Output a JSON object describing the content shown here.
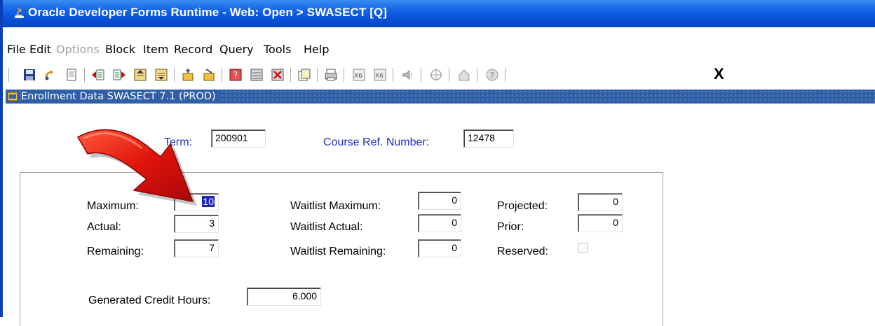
{
  "window": {
    "title": "Oracle Developer Forms Runtime - Web:  Open > SWASECT [Q]"
  },
  "menu": [
    {
      "label": "File",
      "enabled": true
    },
    {
      "label": "Edit",
      "enabled": true
    },
    {
      "label": "Options",
      "enabled": false
    },
    {
      "label": "Block",
      "enabled": true
    },
    {
      "label": "Item",
      "enabled": true
    },
    {
      "label": "Record",
      "enabled": true
    },
    {
      "label": "Query",
      "enabled": true
    },
    {
      "label": "Tools",
      "enabled": true
    },
    {
      "label": "Help",
      "enabled": true
    }
  ],
  "toolbar": {
    "exit_label": "X"
  },
  "form": {
    "title": "Enrollment Data  SWASECT  7.1  (PROD)"
  },
  "key": {
    "term_label": "Term:",
    "term_value": "200901",
    "crn_label": "Course Ref. Number:",
    "crn_value": "12478"
  },
  "enrollment": {
    "maximum_label": "Maximum:",
    "maximum_value": "10",
    "actual_label": "Actual:",
    "actual_value": "3",
    "remaining_label": "Remaining:",
    "remaining_value": "7",
    "wl_max_label": "Waitlist Maximum:",
    "wl_max_value": "0",
    "wl_actual_label": "Waitlist Actual:",
    "wl_actual_value": "0",
    "wl_remaining_label": "Waitlist Remaining:",
    "wl_remaining_value": "0",
    "projected_label": "Projected:",
    "projected_value": "0",
    "prior_label": "Prior:",
    "prior_value": "0",
    "reserved_label": "Reserved:",
    "reserved_checked": false,
    "credit_hours_label": "Generated Credit Hours:",
    "credit_hours_value": "6.000"
  },
  "colors": {
    "titlebar": "#0a50d8",
    "form_title": "#2f5fa6",
    "key_label": "#1c2fc8",
    "selection": "#1a26b8",
    "arrow": "#e0140c"
  }
}
